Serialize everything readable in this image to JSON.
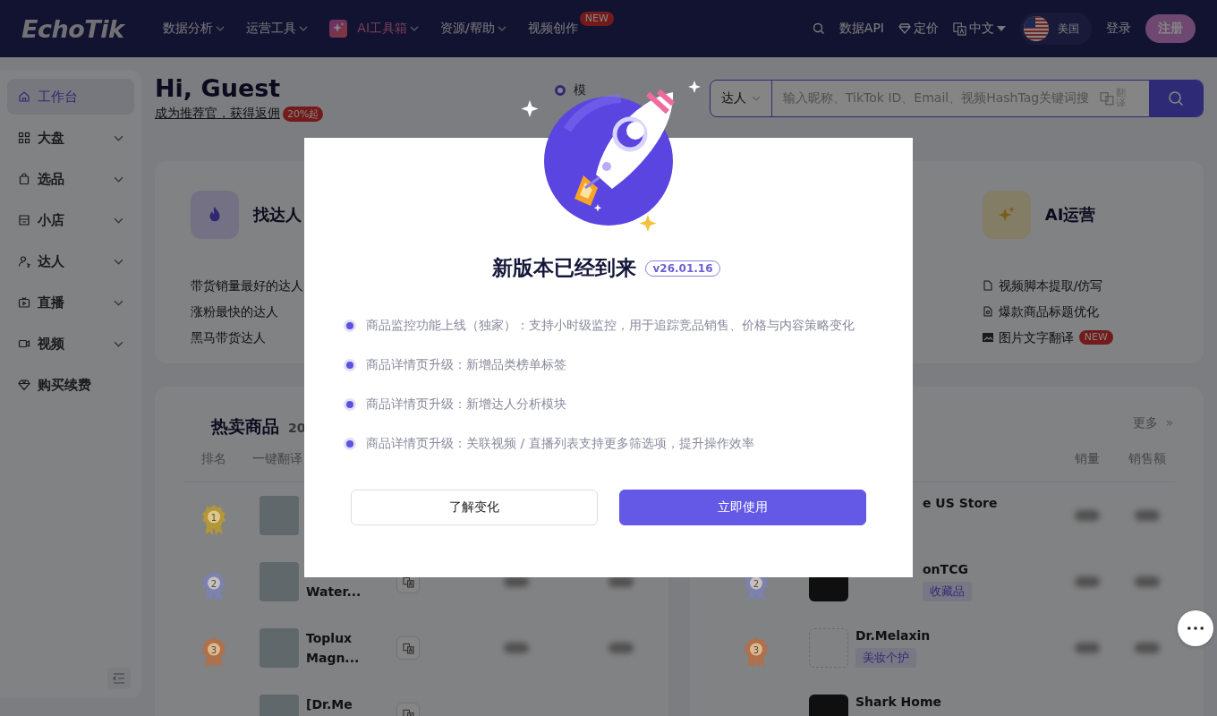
{
  "header": {
    "logo": "EchoTik",
    "nav": [
      {
        "label": "数据分析",
        "kind": "menu"
      },
      {
        "label": "运营工具",
        "kind": "menu"
      },
      {
        "label": "AI工具箱",
        "kind": "ai"
      },
      {
        "label": "资源/帮助",
        "kind": "menu"
      },
      {
        "label": "视频创作",
        "kind": "plain",
        "badge": "NEW"
      }
    ],
    "actions": {
      "api": "数据API",
      "pricing": "定价",
      "language": "中文",
      "region": "美国",
      "login": "登录",
      "register": "注册"
    }
  },
  "sidebar": {
    "items": [
      {
        "label": "工作台",
        "kind": "link",
        "selected": true
      },
      {
        "label": "大盘",
        "kind": "group",
        "selected": false
      },
      {
        "label": "选品",
        "kind": "group",
        "selected": false
      },
      {
        "label": "小店",
        "kind": "group",
        "selected": false
      },
      {
        "label": "达人",
        "kind": "group",
        "selected": false
      },
      {
        "label": "直播",
        "kind": "group",
        "selected": false
      },
      {
        "label": "视频",
        "kind": "group",
        "selected": false
      },
      {
        "label": "购买续费",
        "kind": "link",
        "selected": false
      }
    ]
  },
  "greeting": {
    "title": "Hi, Guest",
    "referral": "成为推荐官，获得返佣",
    "badge": "20%起"
  },
  "search": {
    "mode": {
      "label": "模",
      "selected": true
    },
    "scope": "达人",
    "placeholder": "输入昵称、TikTok ID、Email、视频HashTag关键词搜",
    "translate": "翻译"
  },
  "features": [
    {
      "title": "找达人",
      "kind": "creator",
      "links": [
        {
          "label": "带货销量最好的达人"
        },
        {
          "label": "涨粉最快的达人"
        },
        {
          "label": "黑马带货达人"
        }
      ]
    },
    {
      "title": "AI运营",
      "kind": "ai",
      "links": [
        {
          "label": "视频脚本提取/仿写"
        },
        {
          "label": "爆款商品标题优化"
        },
        {
          "label": "图片文字翻译",
          "badge": "NEW"
        }
      ]
    }
  ],
  "hot_products": {
    "title": "热卖商品",
    "subtitle": "20",
    "columns": [
      "排名",
      "一键翻译"
    ],
    "rows": [
      {
        "rank": "1",
        "color": "#b3963a"
      },
      {
        "rank": "2",
        "color": "#7c82ad",
        "name_end": "Water..."
      },
      {
        "rank": "3",
        "color": "#b0704a",
        "name": "Toplux Magn..."
      },
      {
        "name": "[Dr.Me"
      }
    ]
  },
  "shops": {
    "more": "更多",
    "more_icon": "»",
    "columns": [
      "销量",
      "销售额"
    ],
    "rows": [
      {
        "name_end": "e US Store"
      },
      {
        "rank": "2",
        "color": "#7c82ad",
        "name_end": "onTCG",
        "tag": "收藏品"
      },
      {
        "rank": "3",
        "color": "#b0704a",
        "name": "Dr.Melaxin",
        "tag": "美妆个护"
      },
      {
        "name": "Shark Home"
      }
    ]
  },
  "modal": {
    "title": "新版本已经到来",
    "version": "v26.01.16",
    "items": [
      "商品监控功能上线（独家）：支持小时级监控，用于追踪竞品销售、价格与内容策略变化",
      "商品详情页升级：新增品类榜单标签",
      "商品详情页升级：新增达人分析模块",
      "商品详情页升级：关联视频 / 直播列表支持更多筛选项，提升操作效率"
    ],
    "buttons": [
      {
        "label": "了解变化",
        "kind": "secondary"
      },
      {
        "label": "立即使用",
        "kind": "primary"
      }
    ]
  }
}
